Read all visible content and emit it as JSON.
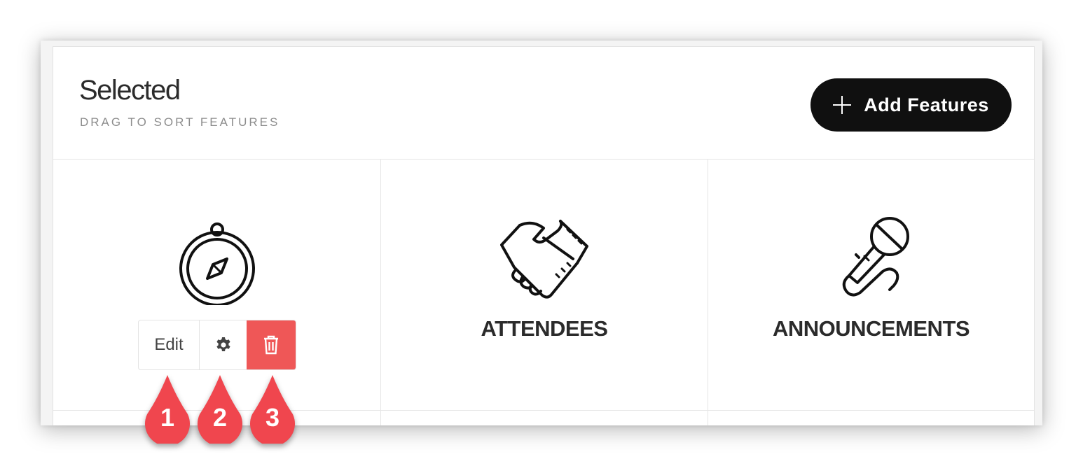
{
  "header": {
    "title": "Selected",
    "subtitle": "DRAG TO SORT FEATURES",
    "add_button_label": "Add Features"
  },
  "features": [
    {
      "label": "",
      "icon": "compass-icon"
    },
    {
      "label": "ATTENDEES",
      "icon": "handshake-icon"
    },
    {
      "label": "ANNOUNCEMENTS",
      "icon": "microphone-icon"
    }
  ],
  "toolbar": {
    "edit_label": "Edit",
    "settings_icon": "gear-icon",
    "delete_icon": "trash-icon"
  },
  "callouts": [
    "1",
    "2",
    "3"
  ],
  "colors": {
    "accent_dark": "#101010",
    "delete_red": "#ef5757",
    "callout_red": "#f0464e"
  }
}
